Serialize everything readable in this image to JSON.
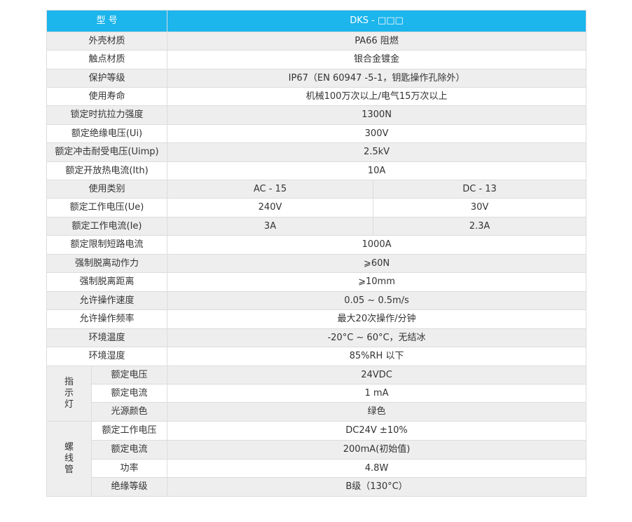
{
  "header": {
    "label": "型 号",
    "value": "DKS - □□□"
  },
  "rows": [
    {
      "label": "外壳材质",
      "value": "PA66  阻燃"
    },
    {
      "label": "触点材质",
      "value": "银合金镀金"
    },
    {
      "label": "保护等级",
      "value": "IP67（EN 60947 -5-1，钥匙操作孔除外）"
    },
    {
      "label": "使用寿命",
      "value": "机械100万次以上/电气15万次以上"
    },
    {
      "label": "锁定时抗拉力强度",
      "value": "1300N"
    },
    {
      "label": "额定绝缘电压(Ui)",
      "value": "300V"
    },
    {
      "label": "额定冲击耐受电压(Uimp)",
      "value": "2.5kV"
    },
    {
      "label": "额定开放热电流(Ith)",
      "value": "10A"
    }
  ],
  "split_rows": [
    {
      "label": "使用类别",
      "ac": "AC - 15",
      "dc": "DC - 13"
    },
    {
      "label": "额定工作电压(Ue)",
      "ac": "240V",
      "dc": "30V"
    },
    {
      "label": "额定工作电流(Ie)",
      "ac": "3A",
      "dc": "2.3A"
    }
  ],
  "rows2": [
    {
      "label": "额定限制短路电流",
      "value": "1000A"
    },
    {
      "label": "强制脱离动作力",
      "value": "⩾60N"
    },
    {
      "label": "强制脱离距离",
      "value": "⩾10mm"
    },
    {
      "label": "允许操作速度",
      "value": "0.05 ~ 0.5m/s"
    },
    {
      "label": "允许操作频率",
      "value": "最大20次操作/分钟"
    },
    {
      "label": "环境温度",
      "value": "-20°C ~ 60°C，无结冰"
    },
    {
      "label": "环境湿度",
      "value": "85%RH 以下"
    }
  ],
  "indicator": {
    "group_chars": [
      "指",
      "示",
      "灯"
    ],
    "rows": [
      {
        "label": "额定电压",
        "value": "24VDC"
      },
      {
        "label": "额定电流",
        "value": "1 mA"
      },
      {
        "label": "光源颜色",
        "value": "绿色"
      }
    ]
  },
  "solenoid": {
    "group_chars": [
      "螺",
      "线",
      "管"
    ],
    "rows": [
      {
        "label": "额定工作电压",
        "value": "DC24V  ±10%"
      },
      {
        "label": "额定电流",
        "value": "200mA(初始值)"
      },
      {
        "label": "功率",
        "value": "4.8W"
      },
      {
        "label": "绝缘等级",
        "value": "B级（130°C）"
      }
    ]
  }
}
